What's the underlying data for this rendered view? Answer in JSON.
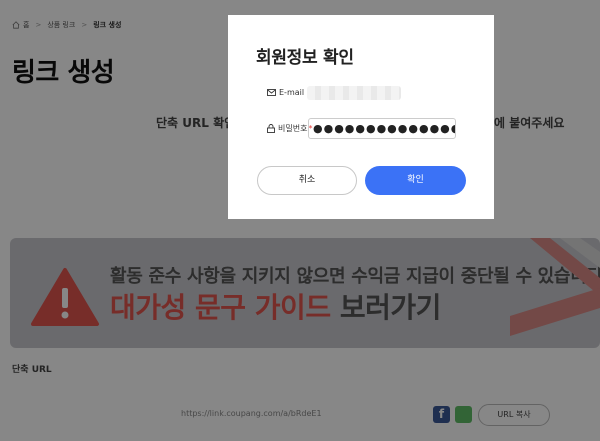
{
  "breadcrumb": {
    "items": [
      "홈",
      "상품 링크",
      "링크 생성"
    ]
  },
  "page": {
    "title": "링크 생성",
    "instruction_left": "단축 URL 확인",
    "instruction_right": "에 붙여주세요"
  },
  "banner": {
    "line1": "활동 준수 사항을 지키지 않으면 수익금 지급이 중단될 수 있습니다.",
    "line2_accent": "대가성 문구 가이드",
    "line2_plain": "보러가기",
    "accent_color": "#e0564f"
  },
  "short_url": {
    "label": "단축 URL",
    "url": "https://link.coupang.com/a/bRdeE1",
    "copy_label": "URL 복사"
  },
  "modal": {
    "title": "회원정보 확인",
    "email_label": "E-mail",
    "password_label": "비밀번호",
    "required_mark": "*",
    "password_value": "●●●●●●●●●●●●●●●●",
    "cancel_label": "취소",
    "confirm_label": "확인",
    "confirm_color": "#3b72f6"
  },
  "icons": [
    "home-icon",
    "mail-icon",
    "lock-icon",
    "warning-icon",
    "facebook-icon",
    "share-icon"
  ]
}
